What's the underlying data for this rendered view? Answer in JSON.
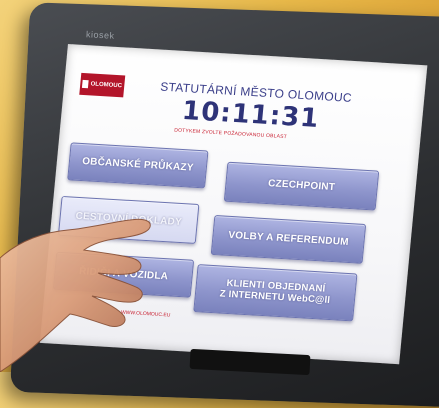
{
  "device": {
    "brand": "kiosek"
  },
  "header": {
    "logo_text": "OLOMOUC",
    "city_title": "STATUTÁRNÍ MĚSTO OLOMOUC",
    "clock": "10:11:31",
    "instruction": "DOTYKEM ZVOLTE POŽADOVANOU OBLAST"
  },
  "buttons": [
    {
      "label": "OBČANSKÉ PRŮKAZY"
    },
    {
      "label": "CZECHPOINT"
    },
    {
      "label": "CESTOVNÍ DOKLADY"
    },
    {
      "label": "VOLBY A REFERENDUM"
    },
    {
      "label": "ŘIDIČI A VOZIDLA"
    },
    {
      "label_line1": "KLIENTI OBJEDNANÍ",
      "label_line2": "Z INTERNETU WebC@ll"
    }
  ],
  "footer": {
    "link_text": "WWW.OLOMOUC.EU"
  },
  "colors": {
    "button_fill": "#8e95cc",
    "title_blue": "#2e3378",
    "accent_red": "#c81d2e",
    "logo_red": "#b3152a"
  }
}
